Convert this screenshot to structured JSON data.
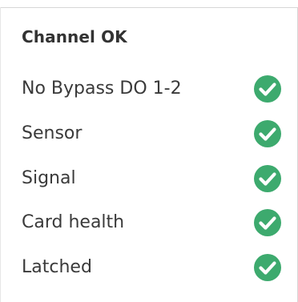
{
  "panel": {
    "title": "Channel OK",
    "status_color": "#3daa6e",
    "items": [
      {
        "label": "No Bypass DO 1-2",
        "status": "ok",
        "icon": "check-circle-icon"
      },
      {
        "label": "Sensor",
        "status": "ok",
        "icon": "check-circle-icon"
      },
      {
        "label": "Signal",
        "status": "ok",
        "icon": "check-circle-icon"
      },
      {
        "label": "Card health",
        "status": "ok",
        "icon": "check-circle-icon"
      },
      {
        "label": "Latched",
        "status": "ok",
        "icon": "check-circle-icon"
      }
    ]
  }
}
